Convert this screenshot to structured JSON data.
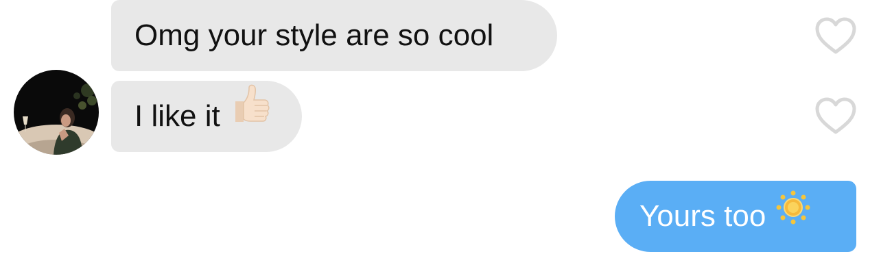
{
  "messages": [
    {
      "sender": "them",
      "text": "Omg your style are so cool"
    },
    {
      "sender": "them",
      "text": "I like it",
      "emoji": "thumbs-up"
    },
    {
      "sender": "me",
      "text": "Yours too",
      "emoji": "sun"
    }
  ],
  "colors": {
    "incoming_bubble": "#e8e8e8",
    "outgoing_bubble": "#5aaef5",
    "heart_outline": "#d8d8d8"
  },
  "icons": {
    "like": "heart-outline-icon",
    "avatar": "contact-avatar-photo"
  }
}
